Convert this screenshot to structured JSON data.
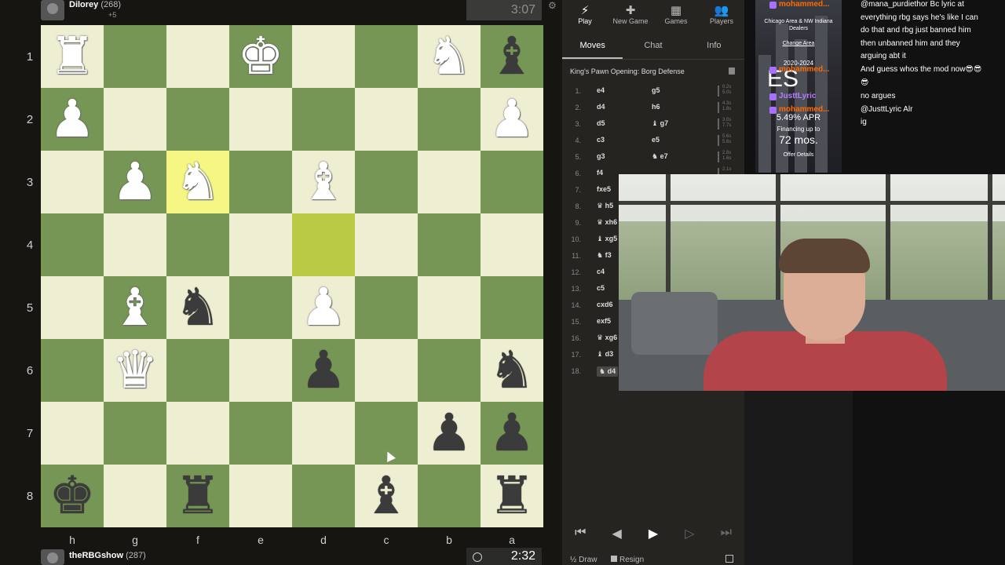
{
  "top_player": {
    "name": "Dilorey",
    "rating": "(268)",
    "sub": "+5",
    "clock": "3:07"
  },
  "bottom_player": {
    "name": "theRBGshow",
    "rating": "(287)",
    "clock": "2:32"
  },
  "ranks": [
    "1",
    "2",
    "3",
    "4",
    "5",
    "6",
    "7",
    "8"
  ],
  "files": [
    "h",
    "g",
    "f",
    "e",
    "d",
    "c",
    "b",
    "a"
  ],
  "board": [
    [
      "wR",
      "",
      "",
      "wK",
      "",
      "",
      "wN",
      "bB"
    ],
    [
      "wP",
      "",
      "",
      "",
      "",
      "",
      "",
      "wP"
    ],
    [
      "",
      "wP",
      "wN",
      "",
      "wB",
      "",
      "",
      ""
    ],
    [
      "",
      "",
      "",
      "",
      "",
      "",
      "",
      ""
    ],
    [
      "",
      "wB",
      "bN",
      "",
      "wP",
      "",
      "",
      ""
    ],
    [
      "",
      "wQ",
      "",
      "",
      "bP",
      "",
      "",
      "bN"
    ],
    [
      "",
      "",
      "",
      "",
      "",
      "",
      "bP",
      "bP"
    ],
    [
      "bK",
      "",
      "bR",
      "",
      "",
      "bB",
      "",
      "bR"
    ]
  ],
  "highlights": [
    [
      2,
      2
    ],
    [
      3,
      4
    ]
  ],
  "piece_glyphs": {
    "K": "♚",
    "Q": "♛",
    "R": "♜",
    "B": "♝",
    "N": "♞",
    "P": "♟"
  },
  "nav": [
    {
      "id": "play",
      "label": "Play",
      "icon": "⚡"
    },
    {
      "id": "new-game",
      "label": "New Game",
      "icon": "✚"
    },
    {
      "id": "games",
      "label": "Games",
      "icon": "▦"
    },
    {
      "id": "players",
      "label": "Players",
      "icon": "👥"
    }
  ],
  "tabs": [
    "Moves",
    "Chat",
    "Info"
  ],
  "opening": "King's Pawn Opening: Borg Defense",
  "moves": [
    {
      "n": "1.",
      "w": "e4",
      "b": "g5",
      "t1": "0.2s",
      "t2": "5.0s"
    },
    {
      "n": "2.",
      "w": "d4",
      "b": "h6",
      "t1": "4.3s",
      "t2": "1.8s"
    },
    {
      "n": "3.",
      "w": "d5",
      "b": "♝ g7",
      "t1": "3.0s",
      "t2": "7.7s"
    },
    {
      "n": "4.",
      "w": "c3",
      "b": "e5",
      "t1": "5.6s",
      "t2": "5.6s"
    },
    {
      "n": "5.",
      "w": "g3",
      "b": "♞ e7",
      "t1": "2.8s",
      "t2": "1.6s"
    },
    {
      "n": "6.",
      "w": "f4",
      "b": "",
      "t1": "2.1s",
      "t2": ""
    },
    {
      "n": "7.",
      "w": "fxe5",
      "b": "",
      "t1": "",
      "t2": ""
    },
    {
      "n": "8.",
      "w": "♛ h5",
      "b": "",
      "t1": "",
      "t2": ""
    },
    {
      "n": "9.",
      "w": "♛ xh6",
      "b": "",
      "t1": "",
      "t2": ""
    },
    {
      "n": "10.",
      "w": "♝ xg5",
      "b": "",
      "t1": "",
      "t2": ""
    },
    {
      "n": "11.",
      "w": "♞ f3",
      "b": "",
      "t1": "",
      "t2": ""
    },
    {
      "n": "12.",
      "w": "c4",
      "b": "",
      "t1": "",
      "t2": ""
    },
    {
      "n": "13.",
      "w": "c5",
      "b": "",
      "t1": "",
      "t2": ""
    },
    {
      "n": "14.",
      "w": "cxd6",
      "b": "",
      "t1": "",
      "t2": ""
    },
    {
      "n": "15.",
      "w": "exf5",
      "b": "",
      "t1": "",
      "t2": ""
    },
    {
      "n": "16.",
      "w": "♛ xg6",
      "b": "",
      "t1": "",
      "t2": ""
    },
    {
      "n": "17.",
      "w": "♝ d3",
      "b": "",
      "t1": "",
      "t2": ""
    },
    {
      "n": "18.",
      "w": "♞ d4",
      "b": "",
      "t1": "",
      "t2": ""
    }
  ],
  "controls": [
    {
      "id": "first",
      "icon": "⏮"
    },
    {
      "id": "prev",
      "icon": "◀"
    },
    {
      "id": "play",
      "icon": "▶"
    },
    {
      "id": "next",
      "icon": "▷"
    },
    {
      "id": "last",
      "icon": "⏭"
    }
  ],
  "actions": {
    "draw": "½ Draw",
    "resign": "Resign"
  },
  "ad": {
    "line1": "Chicago Area & NW Indiana",
    "line2": "Dealers",
    "line3": "Change Area",
    "line4": "2020-2024",
    "big": "ES",
    "line5": "5.49% APR",
    "line6": "Financing up to",
    "line7": "72 mos.",
    "line8": "Offer Details"
  },
  "chat": [
    {
      "user": "mohammed...",
      "color": "#ff6a00",
      "text": "@mana_purdiethor Bc lyric at"
    },
    {
      "user": "",
      "color": "",
      "text": "everything rbg says he's like I can"
    },
    {
      "user": "",
      "color": "",
      "text": "do that and rbg just banned him"
    },
    {
      "user": "",
      "color": "",
      "text": "then unbanned him and they"
    },
    {
      "user": "",
      "color": "",
      "text": "arguing abt it"
    },
    {
      "user": "mohammed...",
      "color": "#ff6a00",
      "text": "And guess whos the mod now😎😎"
    },
    {
      "user": "",
      "color": "",
      "text": "😎"
    },
    {
      "user": "JusttLyric",
      "color": "#b57cff",
      "text": "no argues"
    },
    {
      "user": "mohammed...",
      "color": "#ff6a00",
      "text": "@JusttLyric Alr"
    },
    {
      "user": "",
      "color": "",
      "text": "ig"
    }
  ],
  "colors": {
    "light_sq": "#eeeed2",
    "dark_sq": "#769656",
    "hl_light": "#f6f683",
    "hl_dark": "#baca44"
  }
}
